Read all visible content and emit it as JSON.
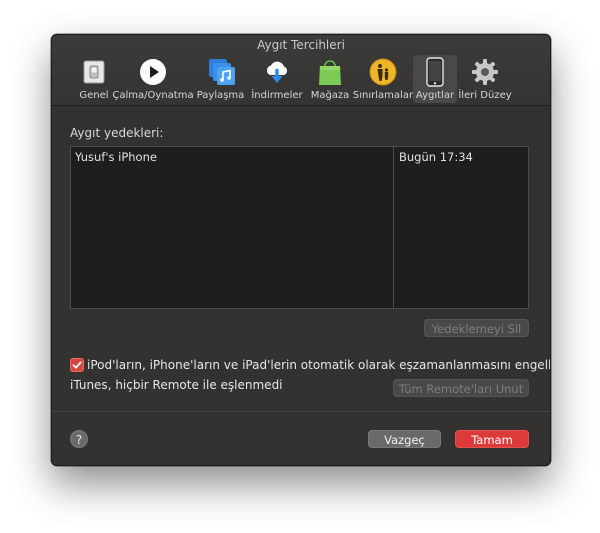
{
  "window": {
    "title": "Aygıt Tercihleri"
  },
  "toolbar": {
    "items": [
      {
        "label": "Genel",
        "icon": "general-switch-icon"
      },
      {
        "label": "Çalma/Oynatma",
        "icon": "play-icon"
      },
      {
        "label": "Paylaşma",
        "icon": "sharing-music-icon"
      },
      {
        "label": "İndirmeler",
        "icon": "cloud-download-icon"
      },
      {
        "label": "Mağaza",
        "icon": "shopping-bag-icon"
      },
      {
        "label": "Sınırlamalar",
        "icon": "parental-restrictions-icon"
      },
      {
        "label": "Aygıtlar",
        "icon": "iphone-icon",
        "active": true
      },
      {
        "label": "İleri Düzey",
        "icon": "gear-icon"
      }
    ]
  },
  "backups": {
    "label": "Aygıt yedekleri:",
    "rows": [
      {
        "device": "Yusuf's iPhone",
        "date": "Bugün 17:34"
      }
    ],
    "delete_button": "Yedeklemeyi Sil"
  },
  "sync": {
    "checkbox_label": "iPod'ların, iPhone'ların ve iPad'lerin otomatik olarak eşzamanlanmasını engelle",
    "checked": true
  },
  "remote": {
    "status": "iTunes, hiçbir Remote ile eşlenmedi",
    "forget_button": "Tüm Remote'ları Unut"
  },
  "footer": {
    "help": "?",
    "cancel": "Vazgeç",
    "ok": "Tamam"
  },
  "colors": {
    "accent": "#dd3b3a"
  }
}
